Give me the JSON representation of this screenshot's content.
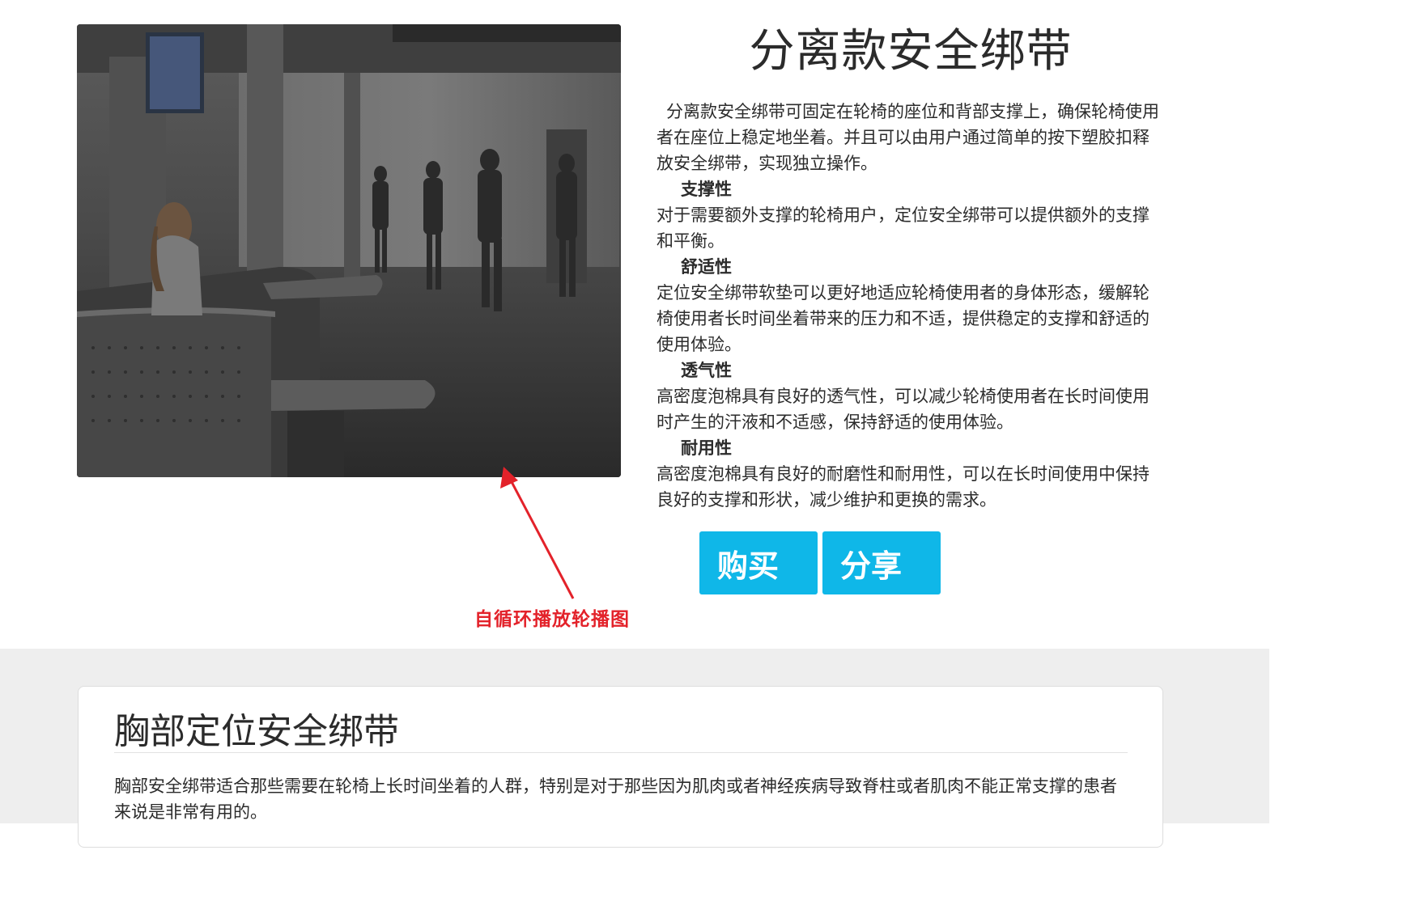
{
  "product": {
    "title": "分离款安全绑带",
    "intro": "分离款安全绑带可固定在轮椅的座位和背部支撑上，确保轮椅使用者在座位上稳定地坐着。并且可以由用户通过简单的按下塑胶扣释放安全绑带，实现独立操作。",
    "features": [
      {
        "title": "支撑性",
        "text": "对于需要额外支撑的轮椅用户，定位安全绑带可以提供额外的支撑和平衡。"
      },
      {
        "title": "舒适性",
        "text": "定位安全绑带软垫可以更好地适应轮椅使用者的身体形态，缓解轮椅使用者长时间坐着带来的压力和不适，提供稳定的支撑和舒适的使用体验。"
      },
      {
        "title": "透气性",
        "text": "高密度泡棉具有良好的透气性，可以减少轮椅使用者在长时间使用时产生的汗液和不适感，保持舒适的使用体验。"
      },
      {
        "title": "耐用性",
        "text": "高密度泡棉具有良好的耐磨性和耐用性，可以在长时间使用中保持良好的支撑和形状，减少维护和更换的需求。"
      }
    ],
    "buy_label": "购买",
    "share_label": "分享"
  },
  "annotation": {
    "text": "自循环播放轮播图",
    "color": "#e3222a"
  },
  "section2": {
    "title": "胸部定位安全绑带",
    "text": "胸部安全绑带适合那些需要在轮椅上长时间坐着的人群，特别是对于那些因为肌肉或者神经疾病导致脊柱或者肌肉不能正常支撑的患者来说是非常有用的。"
  },
  "colors": {
    "accent": "#0fb7e8",
    "section_bg": "#eeeeee"
  }
}
